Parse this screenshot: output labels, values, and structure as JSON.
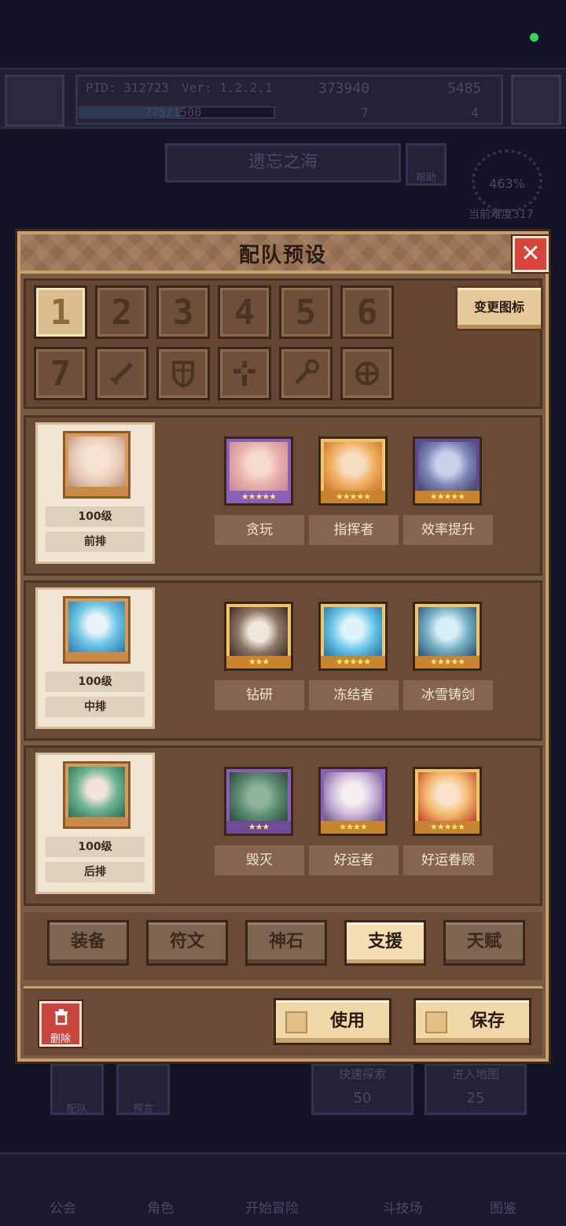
{
  "status_indicator_color": "#36d65c",
  "background": {
    "pid": "PID: 312723",
    "version": "Ver: 1.2.2.1",
    "gold": "373940",
    "gems": "5485",
    "xp": "775/1500",
    "resource_a": "7",
    "resource_b": "4",
    "area_title": "遗忘之海",
    "help_label": "帮助",
    "difficulty_percent": "463%",
    "difficulty_label": "当前难度317",
    "side_buttons": [
      "配队",
      "预言"
    ],
    "quick_labels": [
      "快速探索",
      "进入地图"
    ],
    "quick_values": [
      "50",
      "25"
    ],
    "nav": [
      "公会",
      "角色",
      "开始冒险",
      "斗技场",
      "图鉴"
    ]
  },
  "dialog": {
    "title": "配队预设",
    "change_icon_label": "变更图标",
    "number_slots": [
      "1",
      "2",
      "3",
      "4",
      "5",
      "6",
      "7"
    ],
    "icon_slots": [
      "sword-icon",
      "shield-icon",
      "cross-icon",
      "staff-icon",
      "star-cross-icon"
    ],
    "active_slot": "1"
  },
  "rows": [
    {
      "level": "100级",
      "position": "前排",
      "portrait_color": "#f1d7c8",
      "heroes": [
        {
          "stars": "★★★★★",
          "frame": "#8a5fb8"
        },
        {
          "stars": "★★★★★",
          "frame": "#d39a3c"
        },
        {
          "stars": "★★★★★",
          "frame": "#d39a3c"
        }
      ],
      "skills": [
        "贪玩",
        "指挥者",
        "效率提升"
      ]
    },
    {
      "level": "100级",
      "position": "中排",
      "portrait_color": "#4fb3d9",
      "heroes": [
        {
          "stars": "★★★",
          "frame": "#d39a3c"
        },
        {
          "stars": "★★★★★",
          "frame": "#d39a3c"
        },
        {
          "stars": "★★★★★",
          "frame": "#d39a3c"
        }
      ],
      "skills": [
        "钻研",
        "冻结者",
        "冰雪铸剑"
      ]
    },
    {
      "level": "100级",
      "position": "后排",
      "portrait_color": "#4b9a7a",
      "heroes": [
        {
          "stars": "★★★",
          "frame": "#8a5fb8"
        },
        {
          "stars": "★★★★",
          "frame": "#d39a3c"
        },
        {
          "stars": "★★★★★",
          "frame": "#d39a3c"
        }
      ],
      "skills": [
        "毁灭",
        "好运者",
        "好运眷顾"
      ]
    }
  ],
  "tabs": [
    "装备",
    "符文",
    "神石",
    "支援",
    "天赋"
  ],
  "active_tab": "支援",
  "footer": {
    "delete_label": "删除",
    "use_label": "使用",
    "save_label": "保存"
  }
}
